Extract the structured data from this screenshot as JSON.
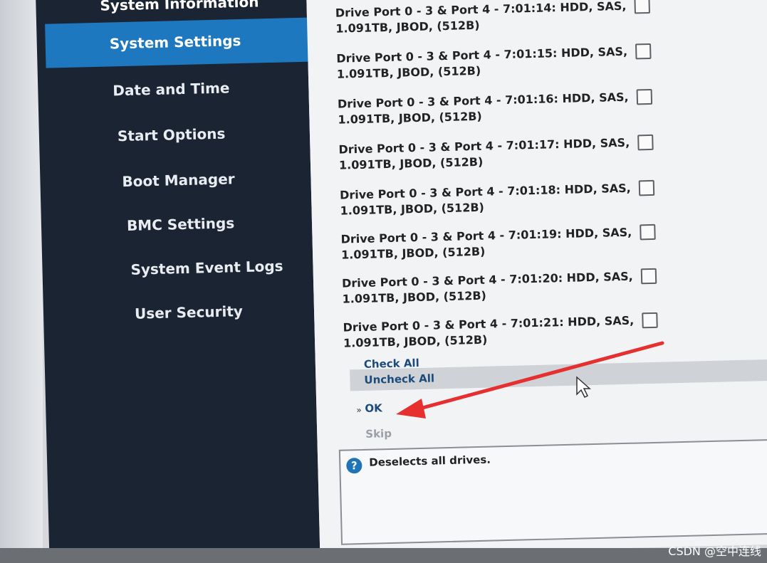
{
  "sidebar": {
    "items": [
      {
        "label": "System Information"
      },
      {
        "label": "System Settings",
        "selected": true
      },
      {
        "label": "Date and Time"
      },
      {
        "label": "Start Options"
      },
      {
        "label": "Boot Manager"
      },
      {
        "label": "BMC Settings"
      },
      {
        "label": "System Event Logs"
      },
      {
        "label": "User Security"
      }
    ],
    "selected_color": "#1e78bf",
    "background": "#1b2433"
  },
  "drives": [
    {
      "line1": "Drive Port 0 - 3 & Port 4 - 7:01:14: HDD, SAS,",
      "line2": "1.091TB, JBOD, (512B)",
      "checked": false
    },
    {
      "line1": "Drive Port 0 - 3 & Port 4 - 7:01:15: HDD, SAS,",
      "line2": "1.091TB, JBOD, (512B)",
      "checked": false
    },
    {
      "line1": "Drive Port 0 - 3 & Port 4 - 7:01:16: HDD, SAS,",
      "line2": "1.091TB, JBOD, (512B)",
      "checked": false
    },
    {
      "line1": "Drive Port 0 - 3 & Port 4 - 7:01:17: HDD, SAS,",
      "line2": "1.091TB, JBOD, (512B)",
      "checked": false
    },
    {
      "line1": "Drive Port 0 - 3 & Port 4 - 7:01:18: HDD, SAS,",
      "line2": "1.091TB, JBOD, (512B)",
      "checked": false
    },
    {
      "line1": "Drive Port 0 - 3 & Port 4 - 7:01:19: HDD, SAS,",
      "line2": "1.091TB, JBOD, (512B)",
      "checked": false
    },
    {
      "line1": "Drive Port 0 - 3 & Port 4 - 7:01:20: HDD, SAS,",
      "line2": "1.091TB, JBOD, (512B)",
      "checked": false
    },
    {
      "line1": "Drive Port 0 - 3 & Port 4 - 7:01:21: HDD, SAS,",
      "line2": "1.091TB, JBOD, (512B)",
      "checked": false
    }
  ],
  "actions": {
    "check_all": "Check All",
    "uncheck_all": "Uncheck All",
    "ok": "OK",
    "ok_marker": "»",
    "skip": "Skip"
  },
  "help": {
    "icon": "?",
    "text": "Deselects all drives."
  },
  "watermark": "CSDN @空中连线",
  "colors": {
    "annotation_arrow": "#e63030",
    "link": "#1c4a7a",
    "disabled": "#9aa0a6"
  }
}
